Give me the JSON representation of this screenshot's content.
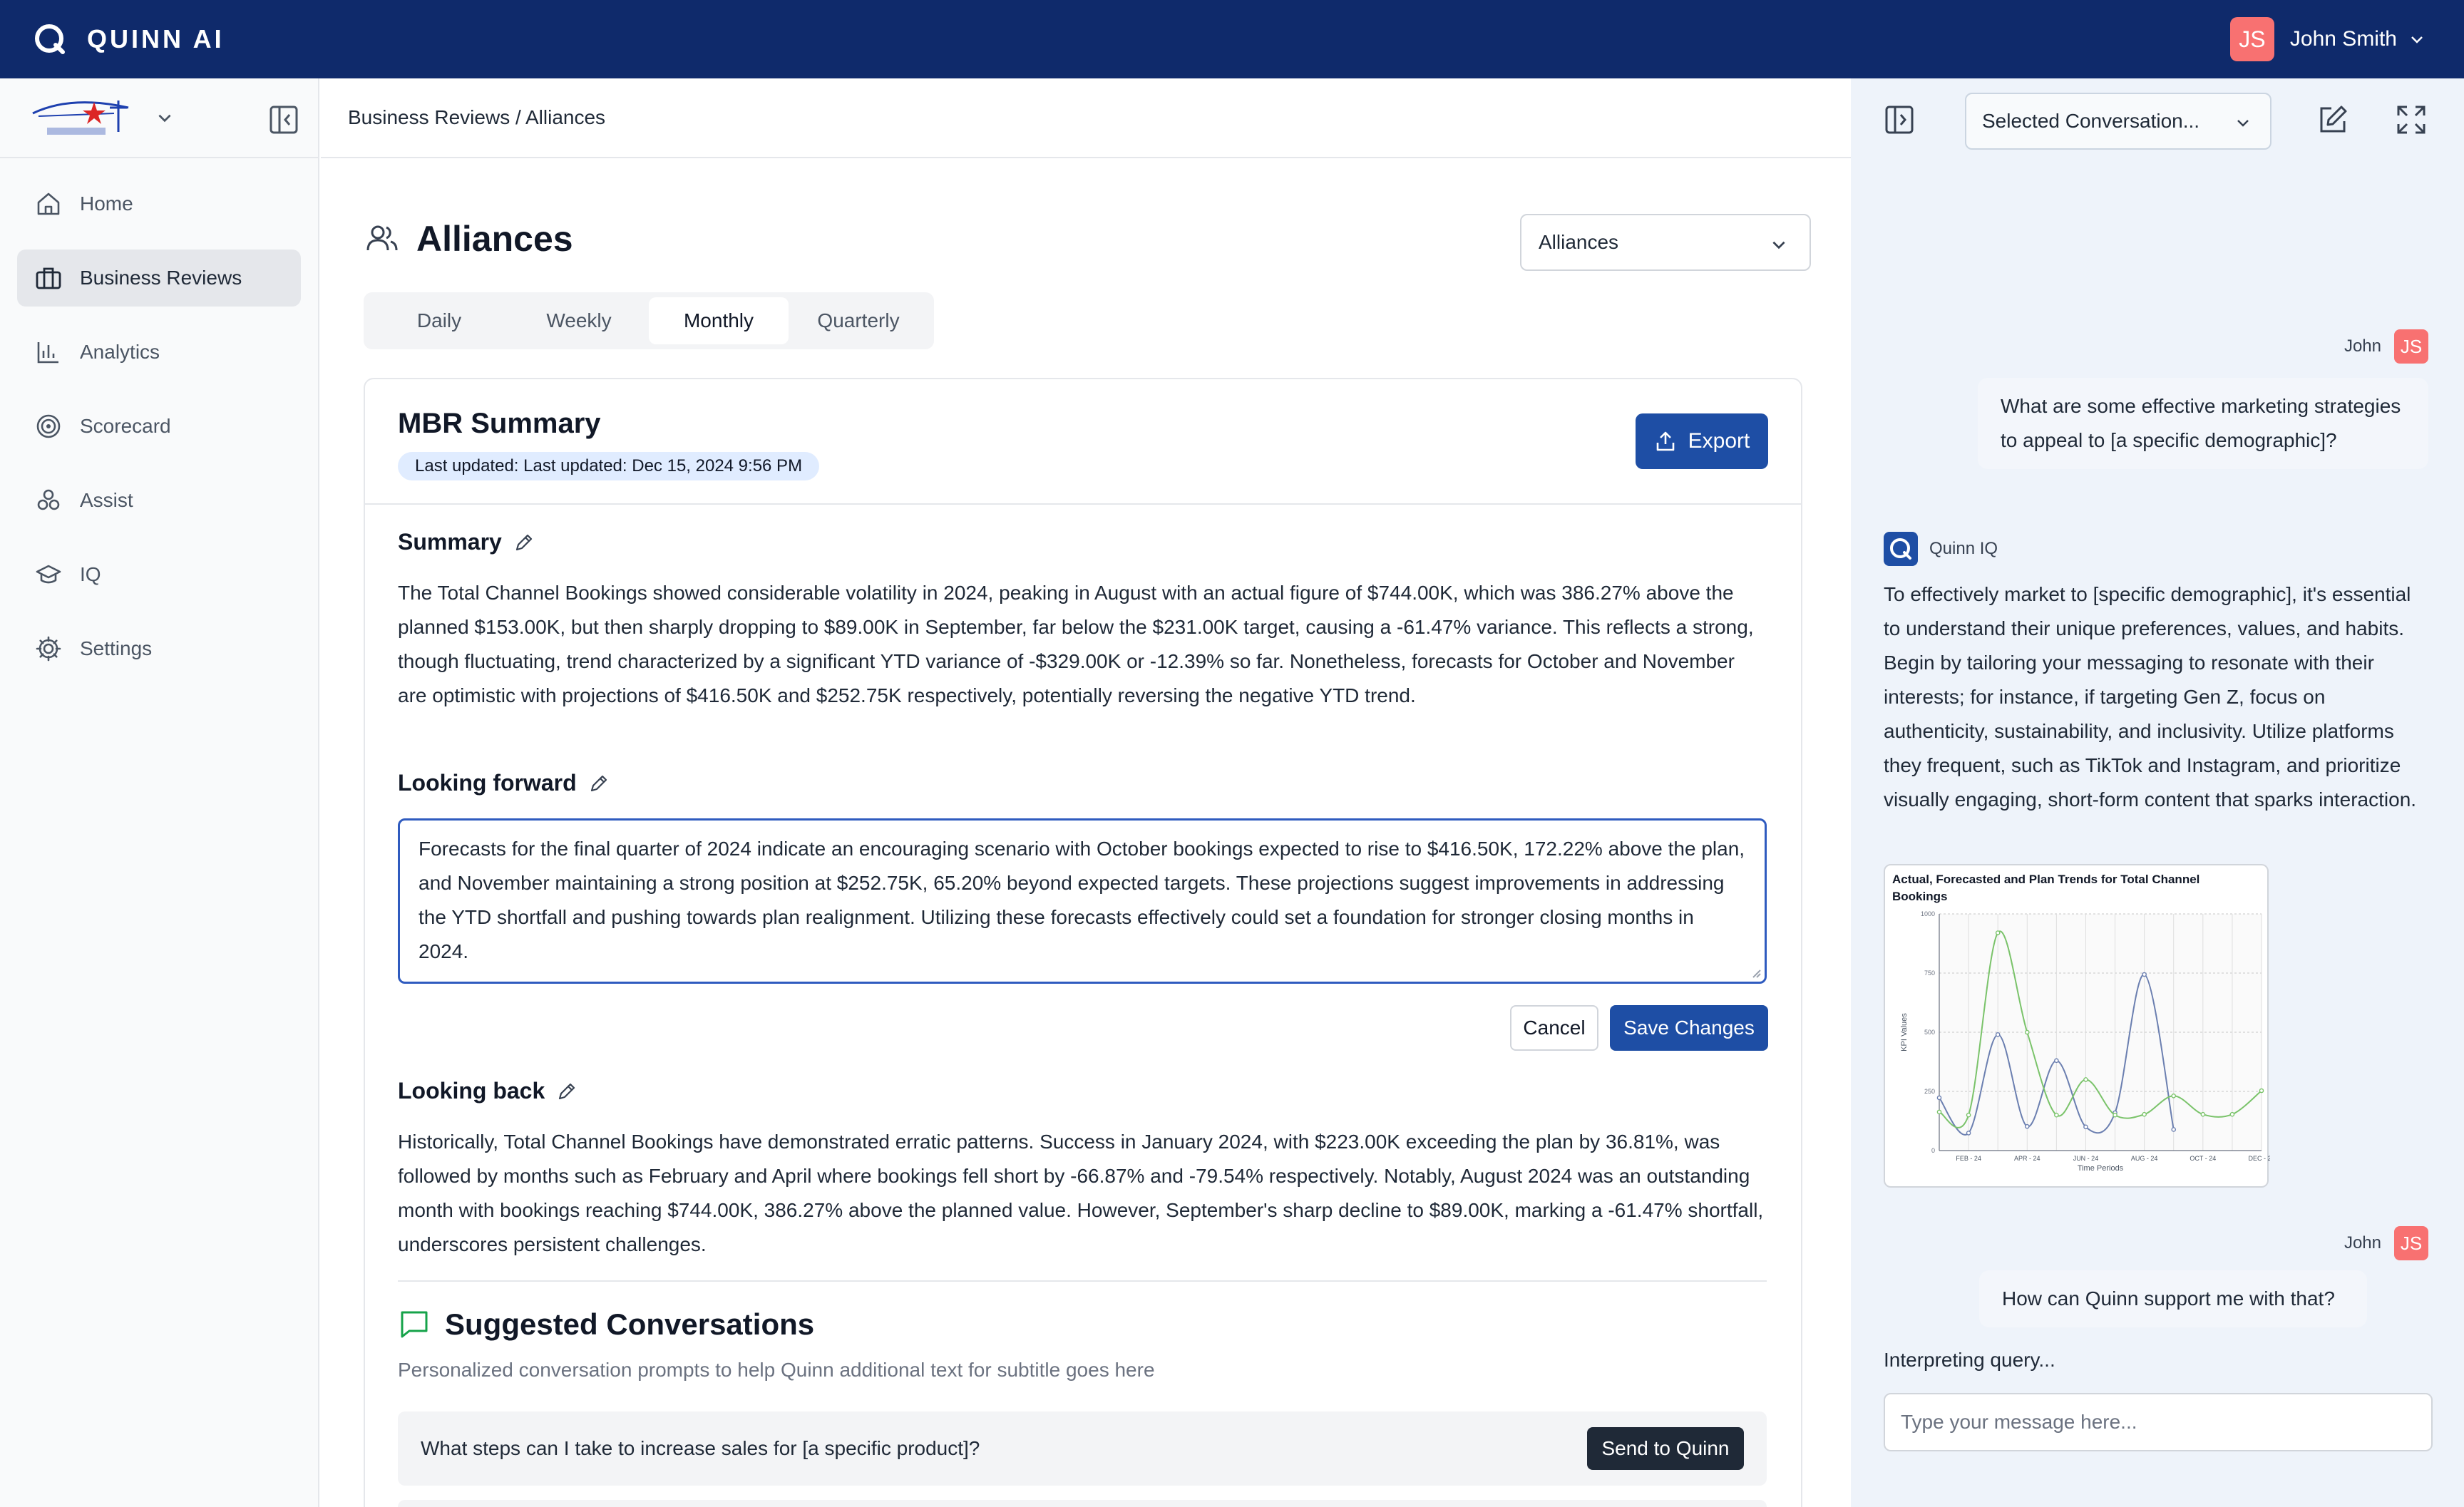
{
  "app": {
    "name": "QUINN AI"
  },
  "user": {
    "initials": "JS",
    "name": "John Smith"
  },
  "sidebar": {
    "items": [
      {
        "label": "Home",
        "icon": "home-icon"
      },
      {
        "label": "Business Reviews",
        "icon": "briefcase-icon",
        "active": true
      },
      {
        "label": "Analytics",
        "icon": "bar-chart-icon"
      },
      {
        "label": "Scorecard",
        "icon": "target-icon"
      },
      {
        "label": "Assist",
        "icon": "assist-icon"
      },
      {
        "label": "IQ",
        "icon": "graduation-cap-icon"
      },
      {
        "label": "Settings",
        "icon": "gear-icon"
      }
    ]
  },
  "breadcrumb": "Business Reviews / Alliances",
  "page": {
    "title": "Alliances",
    "select_value": "Alliances",
    "tabs": [
      "Daily",
      "Weekly",
      "Monthly",
      "Quarterly"
    ],
    "active_tab": "Monthly"
  },
  "card": {
    "title": "MBR Summary",
    "badge": "Last updated: Last updated: Dec 15, 2024 9:56 PM",
    "export_label": "Export",
    "summary_heading": "Summary",
    "summary_text": "The Total Channel Bookings showed considerable volatility in 2024, peaking in August with an actual figure of $744.00K, which was 386.27% above the planned $153.00K, but then sharply dropping to $89.00K in September, far below the $231.00K target, causing a -61.47% variance. This reflects a strong, though fluctuating, trend characterized by a significant YTD variance of -$329.00K or -12.39% so far. Nonetheless, forecasts for October and November are optimistic with projections of $416.50K and $252.75K respectively, potentially reversing the negative YTD trend.",
    "forward_heading": "Looking forward",
    "forward_text": "Forecasts for the final quarter of 2024 indicate an encouraging scenario with October bookings expected to rise to $416.50K, 172.22% above the plan, and November maintaining a strong position at $252.75K, 65.20% beyond expected targets. These projections suggest improvements in addressing the YTD shortfall and pushing towards plan realignment. Utilizing these forecasts effectively could set a foundation for stronger closing months in 2024.",
    "cancel_label": "Cancel",
    "save_label": "Save Changes",
    "back_heading": "Looking back",
    "back_text": "Historically, Total Channel Bookings have demonstrated erratic patterns. Success in January 2024, with $223.00K exceeding the plan by 36.81%, was followed by months such as February and April where bookings fell short by -66.87% and -79.54% respectively. Notably, August 2024 was an outstanding month with bookings reaching $744.00K, 386.27% above the planned value. However, September's sharp decline to $89.00K, marking a -61.47% shortfall, underscores persistent challenges."
  },
  "suggested": {
    "title": "Suggested Conversations",
    "subtitle": "Personalized conversation prompts to help Quinn additional text for subtitle goes here",
    "items": [
      {
        "text": "What steps can I take to increase sales for [a specific product]?",
        "button": "Send to Quinn"
      }
    ]
  },
  "chat": {
    "conversation_select": "Selected Conversation...",
    "messages": [
      {
        "sender": "John",
        "initials": "JS",
        "text": "What are some effective marketing strategies to appeal to [a specific demographic]?"
      },
      {
        "sender": "Quinn IQ",
        "text": "To effectively market to [specific demographic], it's essential to understand their unique preferences, values, and habits. Begin by tailoring your messaging to resonate with their interests; for instance, if targeting Gen Z, focus on authenticity, sustainability, and inclusivity. Utilize platforms they frequent, such as TikTok and Instagram, and prioritize visually engaging, short-form content that sparks interaction."
      },
      {
        "sender": "John",
        "initials": "JS",
        "text": "How can Quinn support me with that?"
      }
    ],
    "status": "Interpreting query...",
    "input_placeholder": "Type your message here..."
  },
  "chart_data": {
    "type": "line",
    "title": "Actual, Forecasted and Plan Trends for Total Channel Bookings",
    "xlabel": "Time Periods",
    "ylabel": "KPI Values",
    "ylim": [
      0,
      1000
    ],
    "yticks": [
      0,
      250,
      500,
      750,
      1000
    ],
    "x": [
      "JAN - 24",
      "FEB - 24",
      "MAR - 24",
      "APR - 24",
      "MAY - 24",
      "JUN - 24",
      "JUL - 24",
      "AUG - 24",
      "SEP - 24",
      "OCT - 24",
      "NOV - 24",
      "DEC - 24"
    ],
    "xtick_labels": [
      "FEB - 24",
      "APR - 24",
      "JUN - 24",
      "AUG - 24",
      "OCT - 24",
      "DEC - 24"
    ],
    "series": [
      {
        "color": "#6b7fb0",
        "values": [
          223,
          74,
          490,
          102,
          380,
          100,
          160,
          744,
          89,
          null,
          null,
          null
        ]
      },
      {
        "color": "#7ac36a",
        "values": [
          163,
          150,
          920,
          500,
          150,
          300,
          150,
          153,
          231,
          153,
          153,
          253
        ]
      }
    ]
  }
}
